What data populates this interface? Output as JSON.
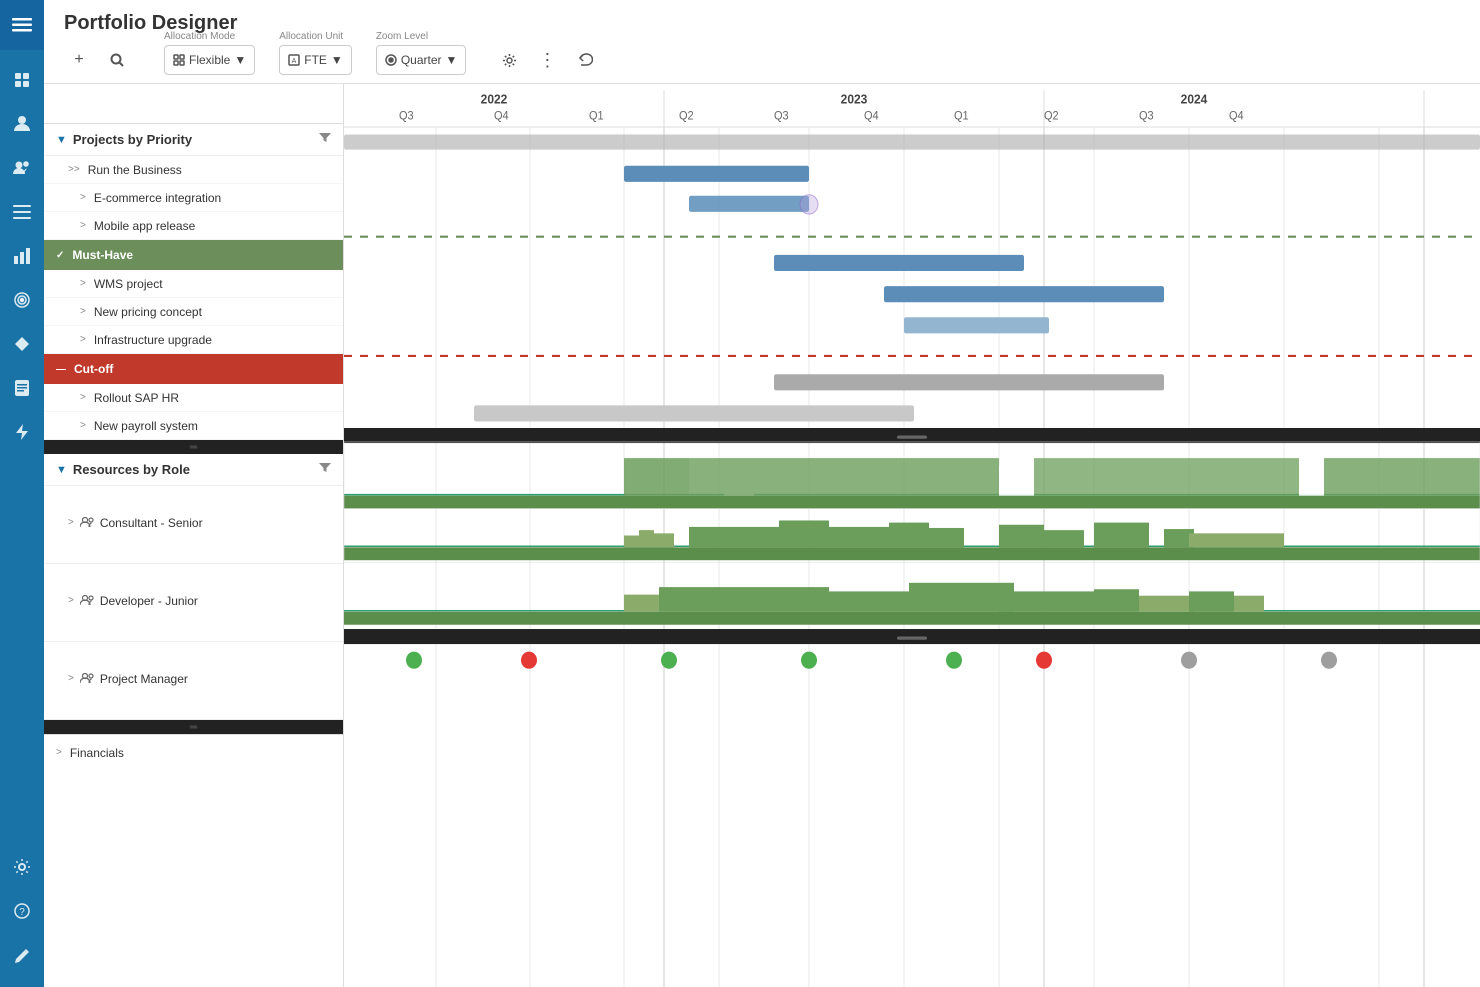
{
  "app": {
    "title": "Portfolio Designer"
  },
  "nav": {
    "logo_icon": "☰",
    "items": [
      {
        "icon": "＋",
        "name": "add"
      },
      {
        "icon": "🔍",
        "name": "search"
      },
      {
        "icon": "👤",
        "name": "profile"
      },
      {
        "icon": "👥",
        "name": "users"
      },
      {
        "icon": "☰",
        "name": "menu"
      },
      {
        "icon": "📊",
        "name": "chart"
      },
      {
        "icon": "🎯",
        "name": "target"
      },
      {
        "icon": "◆",
        "name": "diamond"
      },
      {
        "icon": "📋",
        "name": "clipboard"
      },
      {
        "icon": "⚡",
        "name": "flash"
      },
      {
        "icon": "⚙",
        "name": "settings"
      },
      {
        "icon": "?",
        "name": "help"
      },
      {
        "icon": "✏",
        "name": "edit"
      }
    ]
  },
  "toolbar": {
    "add_label": "+",
    "search_icon": "🔍",
    "allocation_mode_label": "Allocation Mode",
    "allocation_mode_value": "Flexible",
    "allocation_unit_label": "Allocation Unit",
    "allocation_unit_value": "FTE",
    "zoom_level_label": "Zoom Level",
    "zoom_level_value": "Quarter",
    "settings_icon": "⚙",
    "more_icon": "⋮",
    "undo_icon": "↩"
  },
  "projects_section": {
    "label": "Projects by Priority",
    "collapsed": false,
    "items": [
      {
        "label": "Run the Business",
        "indent": 1,
        "type": "group"
      },
      {
        "label": "E-commerce integration",
        "indent": 2
      },
      {
        "label": "Mobile app release",
        "indent": 2
      },
      {
        "label": "Must-Have",
        "type": "priority-band",
        "color": "must-have"
      },
      {
        "label": "WMS project",
        "indent": 2
      },
      {
        "label": "New pricing concept",
        "indent": 2
      },
      {
        "label": "Infrastructure upgrade",
        "indent": 2
      },
      {
        "label": "Cut-off",
        "type": "priority-band",
        "color": "cut-off"
      },
      {
        "label": "Rollout SAP HR",
        "indent": 2
      },
      {
        "label": "New payroll system",
        "indent": 2
      }
    ]
  },
  "resources_section": {
    "label": "Resources by Role",
    "collapsed": false,
    "items": [
      {
        "label": "Consultant - Senior",
        "icon": "role"
      },
      {
        "label": "Developer - Junior",
        "icon": "role"
      },
      {
        "label": "Project Manager",
        "icon": "role"
      }
    ]
  },
  "financials": {
    "label": "Financials",
    "dots": [
      {
        "x_pct": 8,
        "color": "green"
      },
      {
        "x_pct": 16,
        "color": "red"
      },
      {
        "x_pct": 30,
        "color": "green"
      },
      {
        "x_pct": 44,
        "color": "green"
      },
      {
        "x_pct": 57,
        "color": "green"
      },
      {
        "x_pct": 64,
        "color": "red"
      },
      {
        "x_pct": 78,
        "color": "gray"
      },
      {
        "x_pct": 86,
        "color": "gray"
      }
    ]
  },
  "timeline": {
    "years": [
      {
        "label": "2022",
        "x_pct": 8
      },
      {
        "label": "2023",
        "x_pct": 45
      },
      {
        "label": "2024",
        "x_pct": 82
      }
    ],
    "quarters": [
      {
        "label": "Q3",
        "x_pct": 2
      },
      {
        "label": "Q4",
        "x_pct": 10
      },
      {
        "label": "Q1",
        "x_pct": 20
      },
      {
        "label": "Q2",
        "x_pct": 29
      },
      {
        "label": "Q3",
        "x_pct": 38
      },
      {
        "label": "Q4",
        "x_pct": 47
      },
      {
        "label": "Q1",
        "x_pct": 56
      },
      {
        "label": "Q2",
        "x_pct": 65
      },
      {
        "label": "Q3",
        "x_pct": 74
      },
      {
        "label": "Q4",
        "x_pct": 83
      }
    ]
  },
  "gantt_bars": {
    "ecommerce": {
      "left_pct": 25,
      "width_pct": 18
    },
    "mobile": {
      "left_pct": 31,
      "width_pct": 12
    },
    "wms": {
      "left_pct": 41,
      "width_pct": 23
    },
    "pricing": {
      "left_pct": 49,
      "width_pct": 25
    },
    "infra": {
      "left_pct": 49,
      "width_pct": 12
    },
    "rollout_sap": {
      "left_pct": 41,
      "width_pct": 35
    },
    "new_payroll": {
      "left_pct": 14,
      "width_pct": 35
    }
  },
  "colors": {
    "must_have": "#6b8e5a",
    "cut_off": "#c0392b",
    "bar_blue": "#5b8db8",
    "bar_blue_light": "#93b5d0",
    "bar_gray": "#aaa",
    "nav_bg": "#1a73a7",
    "dashed_green": "#6b8e5a",
    "dashed_red": "#c0392b",
    "resource_green": "#6b9e5a"
  }
}
